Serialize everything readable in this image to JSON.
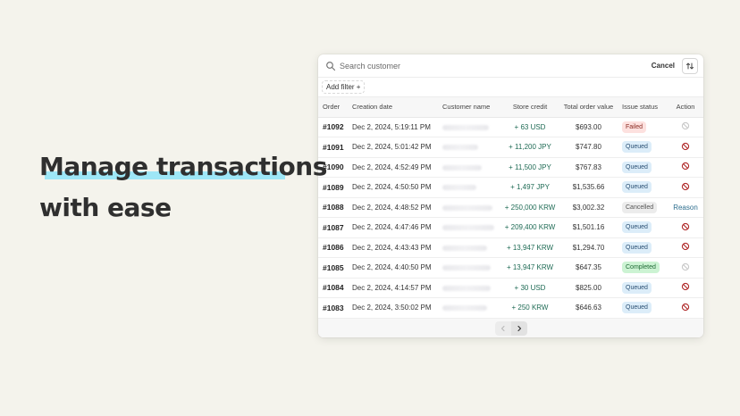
{
  "headline": {
    "line1": "Manage transactions",
    "line2": "with ease"
  },
  "search": {
    "placeholder": "Search customer"
  },
  "toolbar": {
    "cancel_label": "Cancel"
  },
  "filter": {
    "add_label": "Add filter +"
  },
  "columns": [
    "Order",
    "Creation date",
    "Customer name",
    "Store credit",
    "Total order value",
    "Issue status",
    "Action"
  ],
  "rows": [
    {
      "order": "#1092",
      "date": "Dec 2, 2024, 5:19:11 PM",
      "credit": "+ 63 USD",
      "total": "$693.00",
      "status": "Failed",
      "status_color": "#fde1df",
      "action": "ban-icon-muted"
    },
    {
      "order": "#1091",
      "date": "Dec 2, 2024, 5:01:42 PM",
      "credit": "+ 11,200 JPY",
      "total": "$747.80",
      "status": "Queued",
      "status_color": "#dcedf9",
      "action": "ban-icon"
    },
    {
      "order": "#1090",
      "date": "Dec 2, 2024, 4:52:49 PM",
      "credit": "+ 11,500 JPY",
      "total": "$767.83",
      "status": "Queued",
      "status_color": "#dcedf9",
      "action": "ban-icon"
    },
    {
      "order": "#1089",
      "date": "Dec 2, 2024, 4:50:50 PM",
      "credit": "+ 1,497 JPY",
      "total": "$1,535.66",
      "status": "Queued",
      "status_color": "#dcedf9",
      "action": "ban-icon"
    },
    {
      "order": "#1088",
      "date": "Dec 2, 2024, 4:48:52 PM",
      "credit": "+ 250,000 KRW",
      "total": "$3,002.32",
      "status": "Cancelled",
      "status_color": "#ececec",
      "action": "Reason"
    },
    {
      "order": "#1087",
      "date": "Dec 2, 2024, 4:47:46 PM",
      "credit": "+ 209,400 KRW",
      "total": "$1,501.16",
      "status": "Queued",
      "status_color": "#dcedf9",
      "action": "ban-icon"
    },
    {
      "order": "#1086",
      "date": "Dec 2, 2024, 4:43:43 PM",
      "credit": "+ 13,947 KRW",
      "total": "$1,294.70",
      "status": "Queued",
      "status_color": "#dcedf9",
      "action": "ban-icon"
    },
    {
      "order": "#1085",
      "date": "Dec 2, 2024, 4:40:50 PM",
      "credit": "+ 13,947 KRW",
      "total": "$647.35",
      "status": "Completed",
      "status_color": "#ccf3d3",
      "action": "ban-icon-muted"
    },
    {
      "order": "#1084",
      "date": "Dec 2, 2024, 4:14:57 PM",
      "credit": "+ 30 USD",
      "total": "$825.00",
      "status": "Queued",
      "status_color": "#dcedf9",
      "action": "ban-icon"
    },
    {
      "order": "#1083",
      "date": "Dec 2, 2024, 3:50:02 PM",
      "credit": "+ 250 KRW",
      "total": "$646.63",
      "status": "Queued",
      "status_color": "#dcedf9",
      "action": "ban-icon"
    }
  ],
  "colors": {
    "background": "#f4f3ec",
    "highlight": "#9ee7f7",
    "credit_text": "#1f6b55",
    "ban_active": "#b02a2a",
    "ban_muted": "#c8c8c8"
  }
}
